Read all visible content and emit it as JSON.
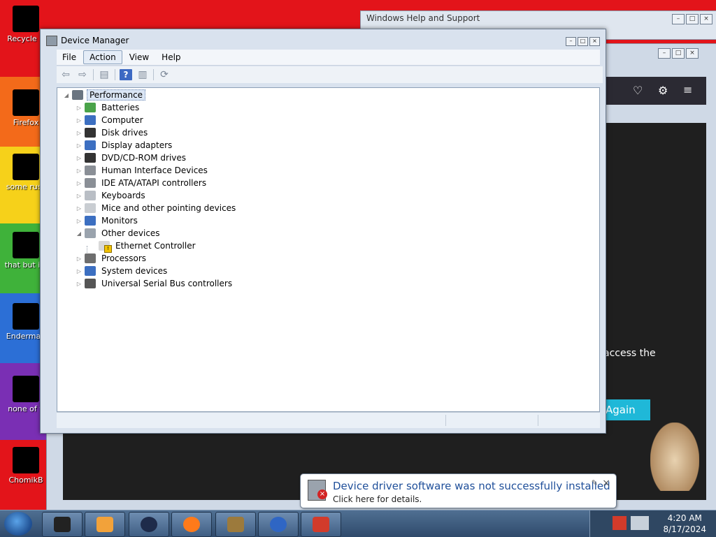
{
  "desktop": {
    "icons": [
      {
        "label": "Recycle Bin",
        "shown": "Recycle B"
      },
      {
        "label": "Firefox",
        "shown": "Firefox"
      },
      {
        "label": "some russ ran a ra",
        "shown": "some russ"
      },
      {
        "label": "that but its",
        "shown": "that but its"
      },
      {
        "label": "Enderman",
        "shown": "Enderman"
      },
      {
        "label": "none of y retards kn",
        "shown": "none of y"
      },
      {
        "label": "ChomikB",
        "shown": "ChomikB"
      }
    ]
  },
  "help_window": {
    "title": "Windows Help and Support"
  },
  "browser": {
    "access_text": "access the",
    "again_button": "Again"
  },
  "device_manager": {
    "title": "Device Manager",
    "menu": [
      "File",
      "Action",
      "View",
      "Help"
    ],
    "active_menu": "Action",
    "root": "Performance",
    "nodes": [
      {
        "label": "Batteries",
        "color": "#4aa34a"
      },
      {
        "label": "Computer",
        "color": "#3c6fc1"
      },
      {
        "label": "Disk drives",
        "color": "#333333"
      },
      {
        "label": "Display adapters",
        "color": "#3c6fc1"
      },
      {
        "label": "DVD/CD-ROM drives",
        "color": "#333333"
      },
      {
        "label": "Human Interface Devices",
        "color": "#8a8f96"
      },
      {
        "label": "IDE ATA/ATAPI controllers",
        "color": "#8a8f96"
      },
      {
        "label": "Keyboards",
        "color": "#b9bec5"
      },
      {
        "label": "Mice and other pointing devices",
        "color": "#c9cdd2"
      },
      {
        "label": "Monitors",
        "color": "#3c6fc1"
      },
      {
        "label": "Other devices",
        "color": "#9aa3ad"
      },
      {
        "label": "Ethernet Controller",
        "color": "#d9d9d9"
      },
      {
        "label": "Processors",
        "color": "#6e6e6e"
      },
      {
        "label": "System devices",
        "color": "#3c6fc1"
      },
      {
        "label": "Universal Serial Bus controllers",
        "color": "#555555"
      }
    ],
    "expanded_node": "Other devices",
    "warning_node": "Ethernet Controller"
  },
  "notification": {
    "title": "Device driver software was not successfully installed",
    "subtitle": "Click here for details."
  },
  "taskbar": {
    "time": "4:20 AM",
    "date": "8/17/2024"
  }
}
